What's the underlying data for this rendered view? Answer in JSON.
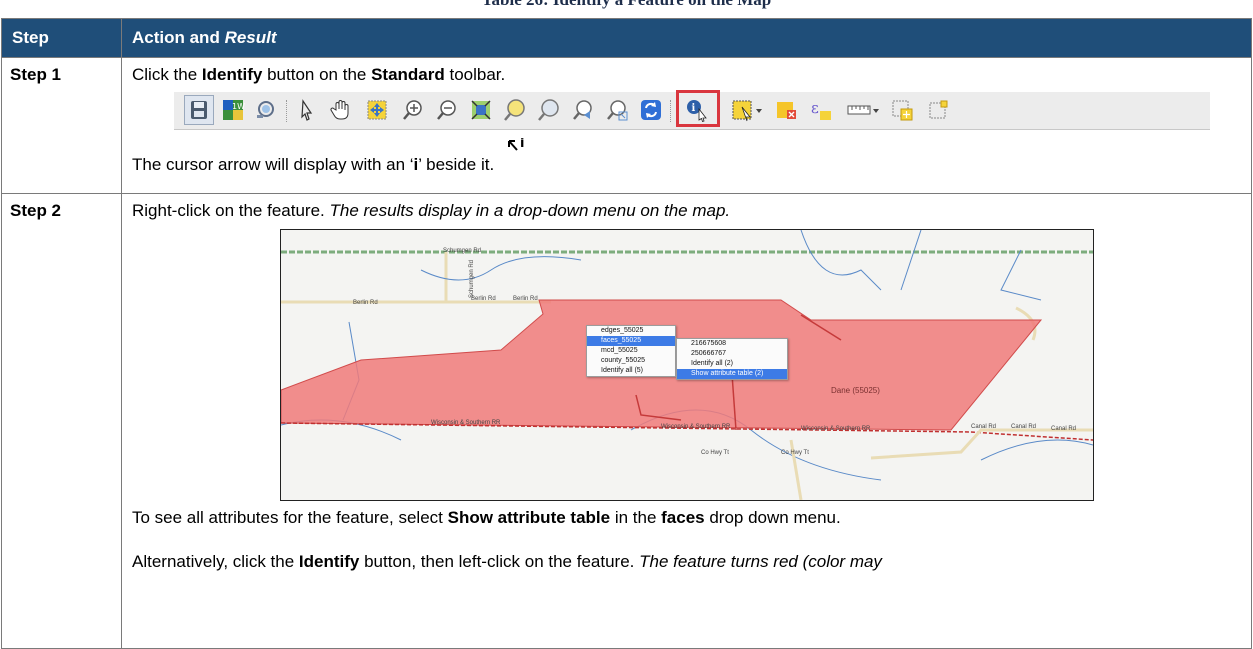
{
  "caption": "Table 26: Identify a Feature on the Map",
  "header": {
    "step": "Step",
    "action_plain": "Action and ",
    "action_italic": "Result"
  },
  "step1": {
    "label": "Step 1",
    "line1": {
      "a": "Click the ",
      "b": "Identify",
      "c": " button on the ",
      "d": "Standard",
      "e": " toolbar."
    },
    "toolbar_icons": [
      "save-icon",
      "new-layer-icon",
      "style-icon",
      "select-arrow-icon",
      "pan-hand-icon",
      "pan-to-selection-icon",
      "zoom-in-icon",
      "zoom-out-icon",
      "zoom-full-icon",
      "zoom-selection-icon",
      "zoom-layer-icon",
      "zoom-last-icon",
      "zoom-next-icon",
      "refresh-icon",
      "identify-icon",
      "select-features-icon",
      "deselect-icon",
      "expression-select-icon",
      "measure-icon",
      "new-feature-icon",
      "add-item-icon"
    ],
    "line2": {
      "a": "The cursor arrow will display with an ‘",
      "b": "i",
      "c": "’ beside it."
    },
    "cursor_letter": "i",
    "highlight_color": "#d9363e"
  },
  "step2": {
    "label": "Step 2",
    "line1": {
      "a": "Right-click on the feature. ",
      "b": "The results display in a drop-down menu on the map."
    },
    "map": {
      "roads": [
        "Schumgen Rd",
        "Schumgen Rd",
        "Berlin Rd",
        "Berlin Rd",
        "Berlin Rd",
        "Wisconsin & Southern RR",
        "Wisconsin & Southern RR",
        "Wisconsin & Southern RR",
        "Co Hwy Tt",
        "Co Hwy Tt",
        "Canal Rd",
        "Canal Rd",
        "Canal Rd"
      ],
      "region_label": "Dane (55025)",
      "polygon_color": "#f07a7a",
      "menu1": [
        "edges_55025",
        "faces_55025",
        "mcd_55025",
        "county_55025",
        "Identify all (5)"
      ],
      "menu2": [
        "216675608",
        "250666767",
        "Identify all (2)",
        "Show attribute table (2)"
      ]
    },
    "line2": {
      "a": "To see all attributes for the feature, select ",
      "b": "Show attribute table",
      "c": " in the ",
      "d": "faces",
      "e": " drop down menu."
    },
    "line3": {
      "a": "Alternatively, click the ",
      "b": "Identify",
      "c": " button, then left-click on the feature. ",
      "d": "The feature turns red (color may"
    }
  }
}
